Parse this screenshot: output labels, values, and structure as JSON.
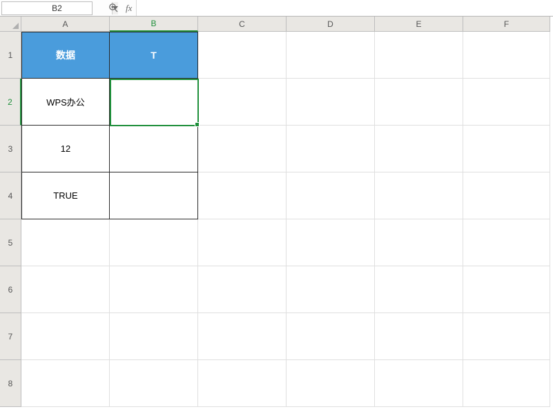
{
  "namebox": {
    "value": "B2"
  },
  "fx": {
    "label": "fx",
    "value": ""
  },
  "columns": [
    "A",
    "B",
    "C",
    "D",
    "E",
    "F"
  ],
  "rows": [
    "1",
    "2",
    "3",
    "4",
    "5",
    "6",
    "7",
    "8"
  ],
  "active": {
    "col": "B",
    "row": "2"
  },
  "cells": {
    "A1": "数据",
    "B1": "T",
    "A2": "WPS办公",
    "A3": "12",
    "A4": "TRUE"
  },
  "chart_data": {
    "type": "table",
    "columns": [
      "数据",
      "T"
    ],
    "rows": [
      [
        "WPS办公",
        ""
      ],
      [
        "12",
        ""
      ],
      [
        "TRUE",
        ""
      ]
    ]
  }
}
